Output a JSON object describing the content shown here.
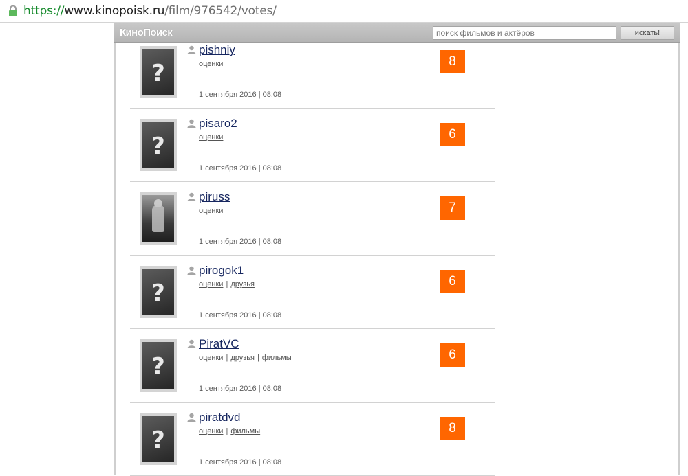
{
  "browser": {
    "url_scheme": "https://",
    "url_host": "www.kinopoisk.ru",
    "url_path": "/film/976542/votes/"
  },
  "header": {
    "logo": "КиноПоиск",
    "search_placeholder": "поиск фильмов и актёров",
    "search_button": "искать!"
  },
  "colors": {
    "score_bg": "#ff6600",
    "username": "#16265f"
  },
  "votes": [
    {
      "username": "pishniy",
      "links": [
        "оценки"
      ],
      "date": "1 сентября 2016 | 08:08",
      "score": "8",
      "avatar": "placeholder"
    },
    {
      "username": "pisaro2",
      "links": [
        "оценки"
      ],
      "date": "1 сентября 2016 | 08:08",
      "score": "6",
      "avatar": "placeholder"
    },
    {
      "username": "piruss",
      "links": [
        "оценки"
      ],
      "date": "1 сентября 2016 | 08:08",
      "score": "7",
      "avatar": "photo"
    },
    {
      "username": "pirogok1",
      "links": [
        "оценки",
        "друзья"
      ],
      "date": "1 сентября 2016 | 08:08",
      "score": "6",
      "avatar": "placeholder"
    },
    {
      "username": "PiratVC",
      "links": [
        "оценки",
        "друзья",
        "фильмы"
      ],
      "date": "1 сентября 2016 | 08:08",
      "score": "6",
      "avatar": "placeholder"
    },
    {
      "username": "piratdvd",
      "links": [
        "оценки",
        "фильмы"
      ],
      "date": "1 сентября 2016 | 08:08",
      "score": "8",
      "avatar": "placeholder"
    }
  ]
}
